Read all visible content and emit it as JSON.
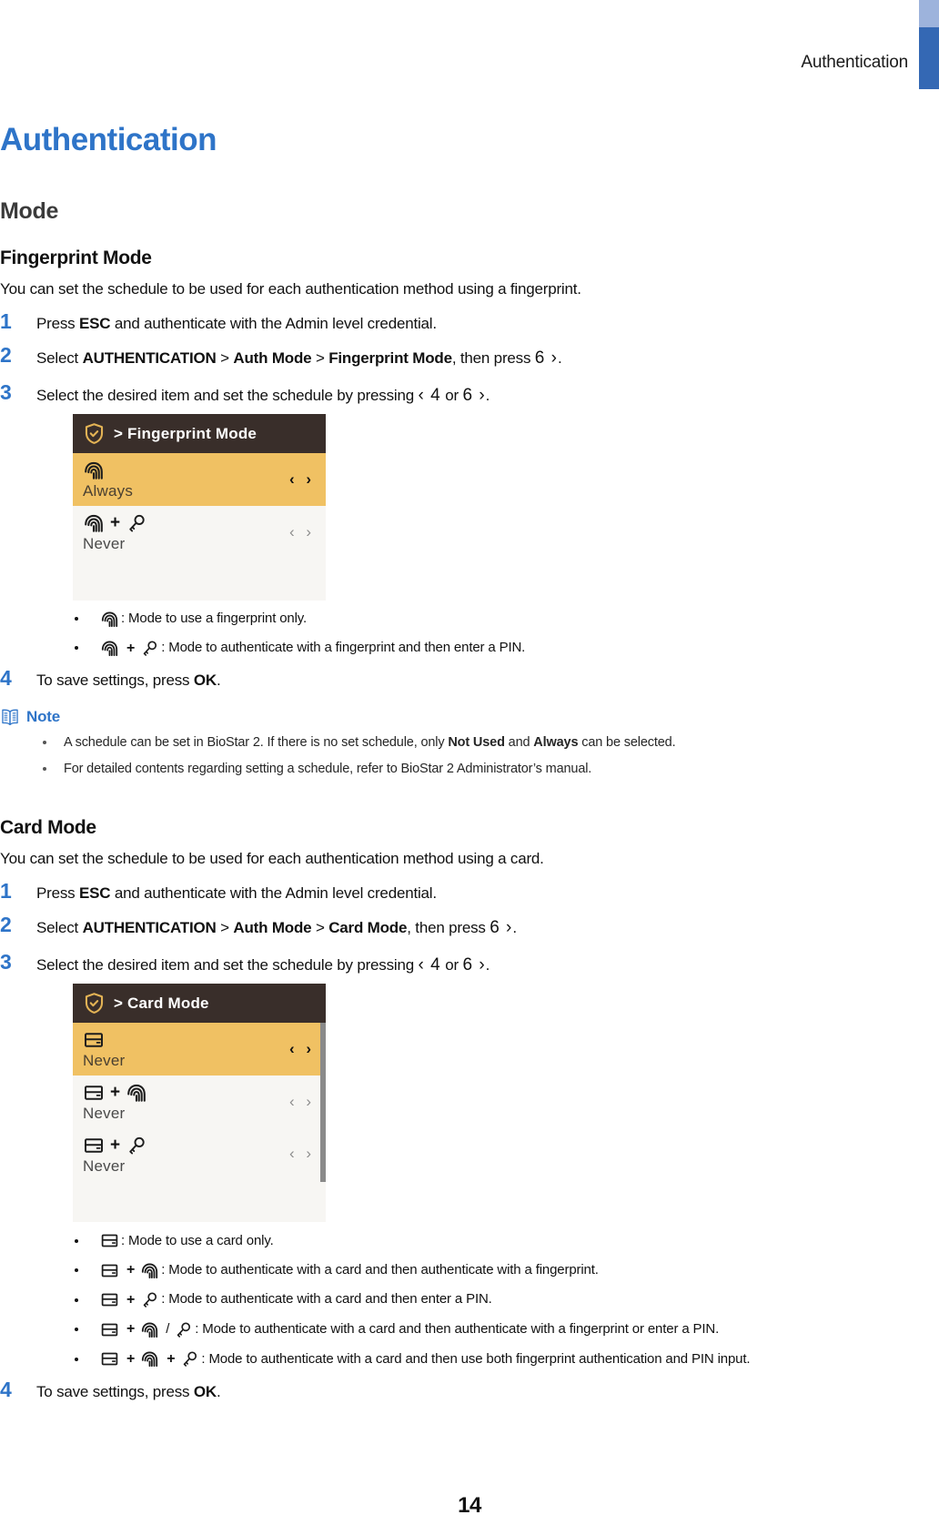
{
  "header": {
    "running_head": "Authentication",
    "bar_light_color": "#9db3dc",
    "bar_dark_color": "#3468b4"
  },
  "title": "Authentication",
  "heading_mode": "Mode",
  "accent_color": "#2e74c8",
  "sections": [
    {
      "id": "fingerprint-mode",
      "heading": "Fingerprint Mode",
      "lead": "You can set the schedule to be used for each authentication method using a fingerprint.",
      "steps": [
        {
          "num": "1",
          "parts": [
            {
              "t": "text",
              "v": "Press "
            },
            {
              "t": "bold",
              "v": "ESC"
            },
            {
              "t": "text",
              "v": " and authenticate with the Admin level credential."
            }
          ]
        },
        {
          "num": "2",
          "parts": [
            {
              "t": "text",
              "v": "Select "
            },
            {
              "t": "bold",
              "v": "AUTHENTICATION"
            },
            {
              "t": "text",
              "v": " > "
            },
            {
              "t": "bold",
              "v": "Auth Mode"
            },
            {
              "t": "text",
              "v": " > "
            },
            {
              "t": "bold",
              "v": "Fingerprint Mode"
            },
            {
              "t": "text",
              "v": ", then press "
            },
            {
              "t": "key",
              "v": "6 ›"
            },
            {
              "t": "text",
              "v": "."
            }
          ]
        },
        {
          "num": "3",
          "parts": [
            {
              "t": "text",
              "v": "Select the desired item and set the schedule by pressing "
            },
            {
              "t": "key",
              "v": "‹ 4"
            },
            {
              "t": "text",
              "v": " or "
            },
            {
              "t": "key",
              "v": "6 ›"
            },
            {
              "t": "text",
              "v": "."
            }
          ]
        },
        {
          "num": "4",
          "parts": [
            {
              "t": "text",
              "v": "To save settings, press "
            },
            {
              "t": "bold",
              "v": "OK"
            },
            {
              "t": "text",
              "v": "."
            }
          ]
        }
      ],
      "device": {
        "title": "> Fingerprint Mode",
        "header_bg": "#392e2a",
        "selected_bg": "#f0c163",
        "row_bg": "#f7f6f3",
        "shield_color": "#e3b355",
        "has_scrollbar": false,
        "rows": [
          {
            "icons": [
              "fingerprint"
            ],
            "value": "Always",
            "selected": true,
            "arrows": "‹ ›"
          },
          {
            "icons": [
              "fingerprint",
              "plus",
              "key"
            ],
            "value": "Never",
            "selected": false,
            "arrows": "‹ ›"
          }
        ]
      },
      "legend": [
        {
          "icons": [
            "fingerprint"
          ],
          "text": ": Mode to use a fingerprint only."
        },
        {
          "icons": [
            "fingerprint",
            "plus",
            "key"
          ],
          "text": ": Mode to authenticate with a fingerprint and then enter a PIN."
        }
      ],
      "note": {
        "label": "Note",
        "items": [
          [
            {
              "t": "text",
              "v": "A schedule can be set in BioStar 2. If there is no set schedule, only "
            },
            {
              "t": "bold",
              "v": "Not Used"
            },
            {
              "t": "text",
              "v": " and "
            },
            {
              "t": "bold",
              "v": "Always"
            },
            {
              "t": "text",
              "v": " can be selected."
            }
          ],
          [
            {
              "t": "text",
              "v": "For detailed contents regarding setting a schedule, refer to BioStar 2 Administrator’s manual."
            }
          ]
        ]
      }
    },
    {
      "id": "card-mode",
      "heading": "Card Mode",
      "lead": "You can set the schedule to be used for each authentication method using a card.",
      "steps": [
        {
          "num": "1",
          "parts": [
            {
              "t": "text",
              "v": "Press "
            },
            {
              "t": "bold",
              "v": "ESC"
            },
            {
              "t": "text",
              "v": " and authenticate with the Admin level credential."
            }
          ]
        },
        {
          "num": "2",
          "parts": [
            {
              "t": "text",
              "v": "Select "
            },
            {
              "t": "bold",
              "v": "AUTHENTICATION"
            },
            {
              "t": "text",
              "v": " > "
            },
            {
              "t": "bold",
              "v": "Auth Mode"
            },
            {
              "t": "text",
              "v": " > "
            },
            {
              "t": "bold",
              "v": "Card Mode"
            },
            {
              "t": "text",
              "v": ", then press "
            },
            {
              "t": "key",
              "v": "6 ›"
            },
            {
              "t": "text",
              "v": "."
            }
          ]
        },
        {
          "num": "3",
          "parts": [
            {
              "t": "text",
              "v": "Select the desired item and set the schedule by pressing "
            },
            {
              "t": "key",
              "v": "‹ 4"
            },
            {
              "t": "text",
              "v": " or "
            },
            {
              "t": "key",
              "v": "6 ›"
            },
            {
              "t": "text",
              "v": "."
            }
          ]
        },
        {
          "num": "4",
          "parts": [
            {
              "t": "text",
              "v": "To save settings, press "
            },
            {
              "t": "bold",
              "v": "OK"
            },
            {
              "t": "text",
              "v": "."
            }
          ]
        }
      ],
      "device": {
        "title": "> Card Mode",
        "header_bg": "#392e2a",
        "selected_bg": "#f0c163",
        "row_bg": "#f7f6f3",
        "shield_color": "#e3b355",
        "has_scrollbar": true,
        "rows": [
          {
            "icons": [
              "card"
            ],
            "value": "Never",
            "selected": true,
            "arrows": "‹ ›"
          },
          {
            "icons": [
              "card",
              "plus",
              "fingerprint"
            ],
            "value": "Never",
            "selected": false,
            "arrows": "‹ ›"
          },
          {
            "icons": [
              "card",
              "plus",
              "key"
            ],
            "value": "Never",
            "selected": false,
            "arrows": "‹ ›"
          }
        ]
      },
      "legend": [
        {
          "icons": [
            "card"
          ],
          "text": ": Mode to use a card only."
        },
        {
          "icons": [
            "card",
            "plus",
            "fingerprint"
          ],
          "text": ": Mode to authenticate with a card and then authenticate with a fingerprint."
        },
        {
          "icons": [
            "card",
            "plus",
            "key"
          ],
          "text": ": Mode to authenticate with a card and then enter a PIN."
        },
        {
          "icons": [
            "card",
            "plus",
            "fingerprint",
            "slash",
            "key"
          ],
          "text": ": Mode to authenticate with a card and then authenticate with a fingerprint or enter a PIN."
        },
        {
          "icons": [
            "card",
            "plus",
            "fingerprint",
            "plus",
            "key"
          ],
          "text": ": Mode to authenticate with a card and then use both fingerprint authentication and PIN input."
        }
      ]
    }
  ],
  "page_number": "14"
}
